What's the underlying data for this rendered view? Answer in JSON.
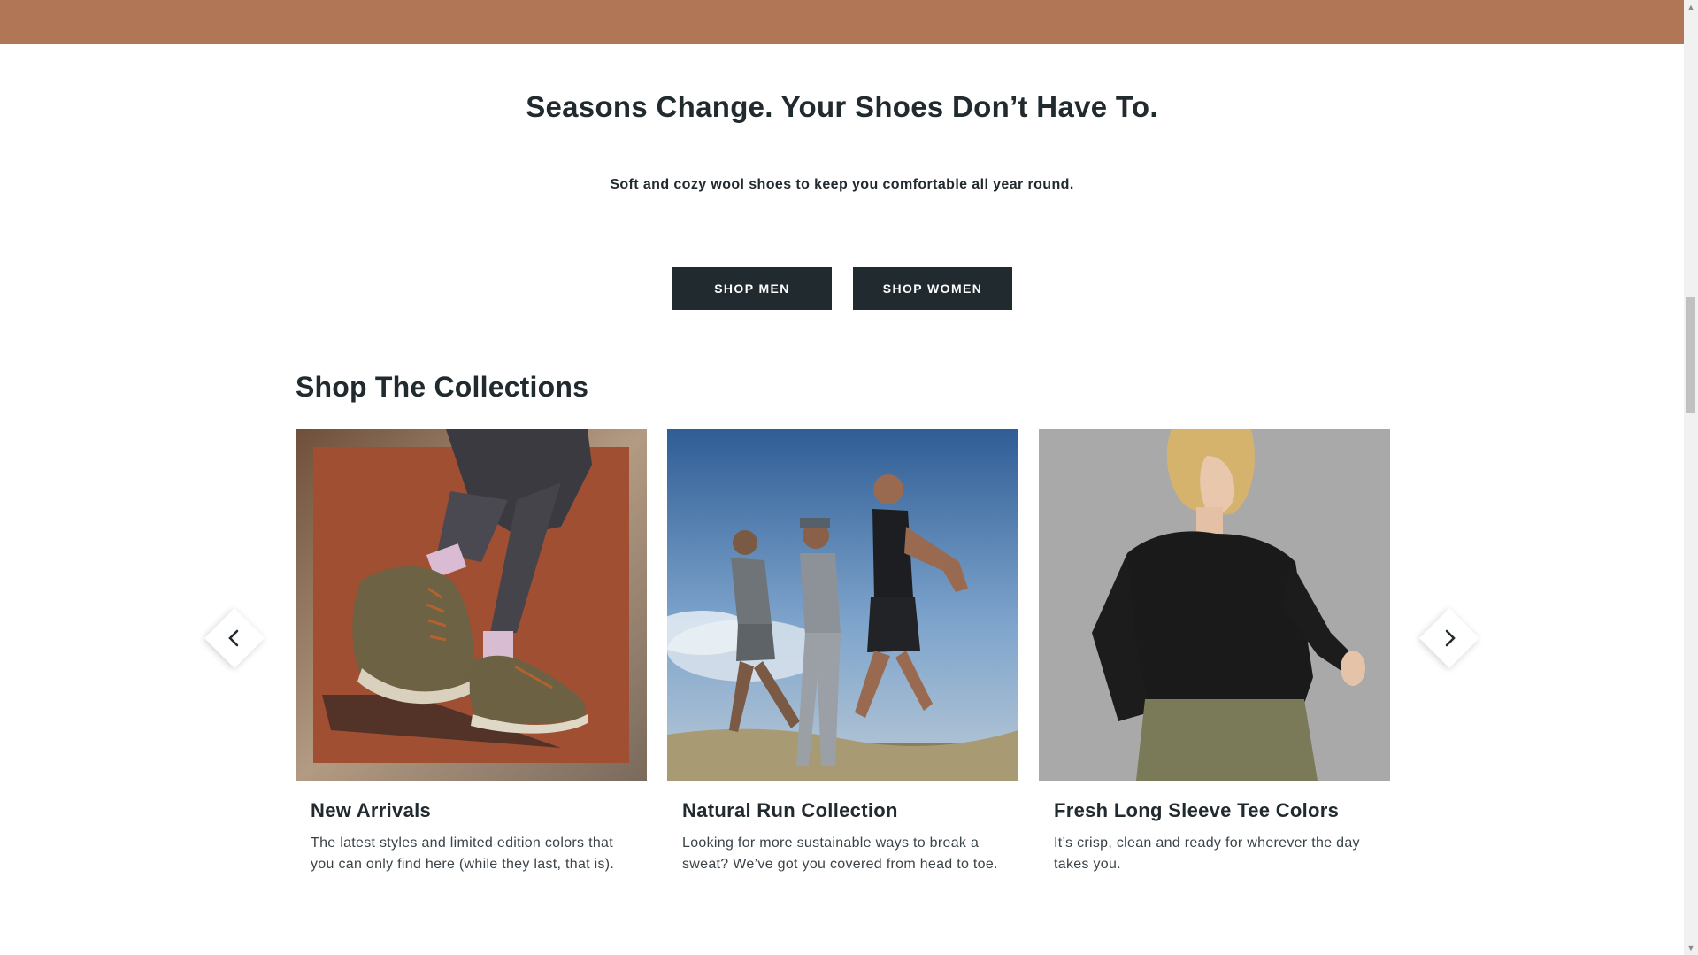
{
  "hero": {
    "title": "Seasons Change. Your Shoes Don’t Have To.",
    "subtitle": "Soft and cozy wool shoes to keep you comfortable all year round.",
    "shop_men_label": "SHOP MEN",
    "shop_women_label": "SHOP WOMEN"
  },
  "collections": {
    "title": "Shop The Collections",
    "items": [
      {
        "title": "New Arrivals",
        "description": "The latest styles and limited edition colors that you can only find here (while they last, that is)."
      },
      {
        "title": "Natural Run Collection",
        "description": "Looking for more sustainable ways to break a sweat? We’ve got you covered from head to toe."
      },
      {
        "title": "Fresh Long Sleeve Tee Colors",
        "description": "It’s crisp, clean and ready for wherever the day takes you."
      }
    ],
    "prev_icon": "chevron-left-icon",
    "next_icon": "chevron-right-icon"
  },
  "colors": {
    "banner": "#b07655",
    "button": "#212a2f",
    "text": "#212a2f"
  }
}
